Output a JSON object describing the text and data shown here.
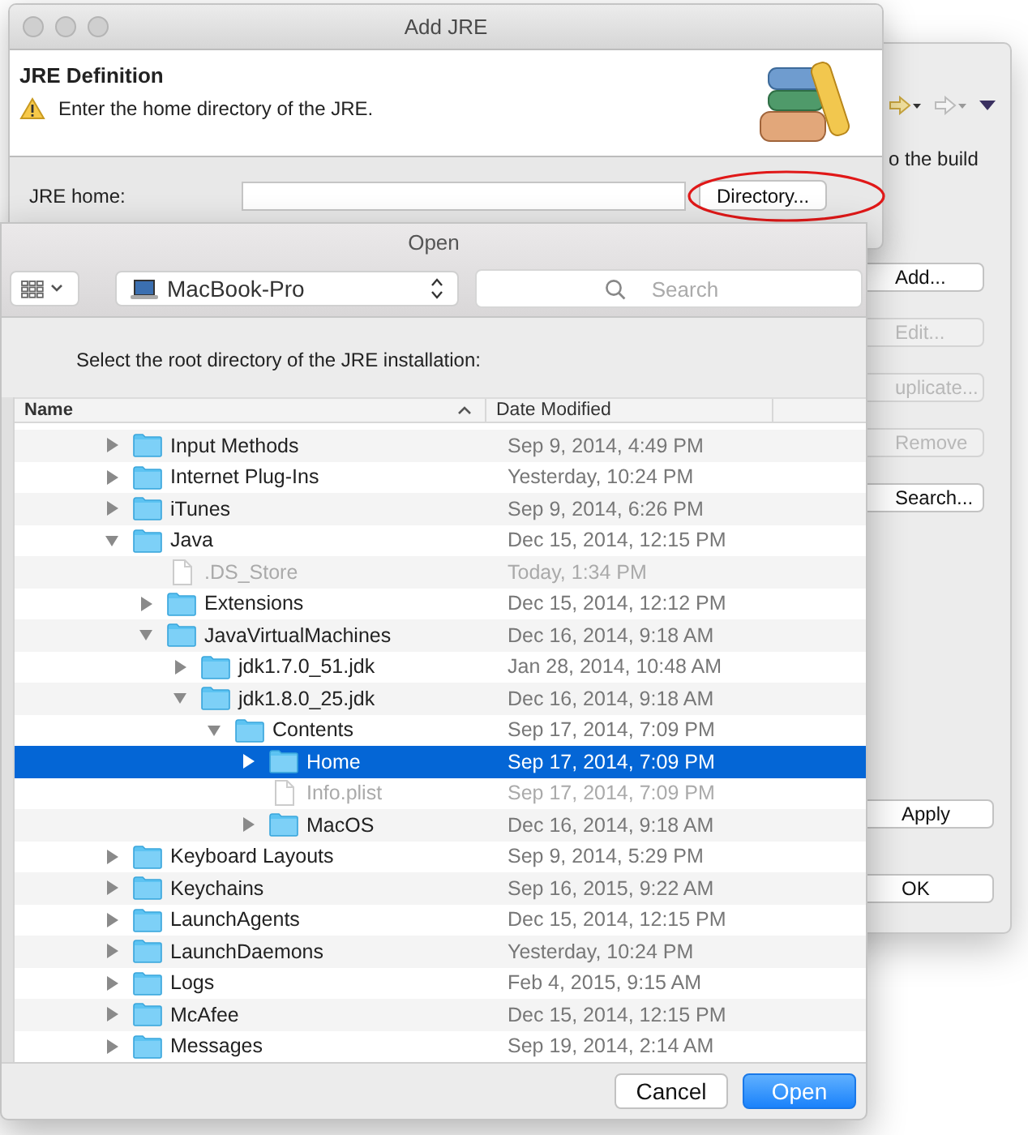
{
  "background_window": {
    "description_text": "o the build",
    "buttons": [
      {
        "label": "Add...",
        "disabled": false
      },
      {
        "label": "Edit...",
        "disabled": true
      },
      {
        "label": "uplicate...",
        "disabled": true
      },
      {
        "label": "Remove",
        "disabled": true
      },
      {
        "label": "Search...",
        "disabled": false
      }
    ],
    "footer_buttons": [
      {
        "label": "Apply"
      },
      {
        "label": "OK"
      }
    ]
  },
  "dialog": {
    "title": "Add JRE",
    "heading": "JRE Definition",
    "message": "Enter the home directory of the JRE.",
    "field_label": "JRE home:",
    "directory_button": "Directory..."
  },
  "open_sheet": {
    "title": "Open",
    "location": "MacBook-Pro",
    "search": {
      "placeholder": "Search"
    },
    "prompt": "Select the root directory of the JRE installation:",
    "columns": [
      {
        "label": "Name",
        "sorted": true
      },
      {
        "label": "Date Modified",
        "sorted": false
      }
    ],
    "files": [
      {
        "name": "Input Methods",
        "kind": "folder",
        "expanded": false,
        "selected": false,
        "date": "Sep 9, 2014, 4:49 PM"
      },
      {
        "name": "Internet Plug-Ins",
        "kind": "folder",
        "expanded": false,
        "selected": false,
        "date": "Yesterday, 10:24 PM"
      },
      {
        "name": "iTunes",
        "kind": "folder",
        "expanded": false,
        "selected": false,
        "date": "Sep 9, 2014, 6:26 PM"
      },
      {
        "name": "Java",
        "kind": "folder",
        "expanded": true,
        "selected": false,
        "date": "Dec 15, 2014, 12:15 PM",
        "children": [
          {
            "name": ".DS_Store",
            "kind": "file",
            "selected": false,
            "date": "Today, 1:34 PM"
          },
          {
            "name": "Extensions",
            "kind": "folder",
            "expanded": false,
            "selected": false,
            "date": "Dec 15, 2014, 12:12 PM"
          },
          {
            "name": "JavaVirtualMachines",
            "kind": "folder",
            "expanded": true,
            "selected": false,
            "date": "Dec 16, 2014, 9:18 AM",
            "children": [
              {
                "name": "jdk1.7.0_51.jdk",
                "kind": "folder",
                "expanded": false,
                "selected": false,
                "date": "Jan 28, 2014, 10:48 AM"
              },
              {
                "name": "jdk1.8.0_25.jdk",
                "kind": "folder",
                "expanded": true,
                "selected": false,
                "date": "Dec 16, 2014, 9:18 AM",
                "children": [
                  {
                    "name": "Contents",
                    "kind": "folder",
                    "expanded": true,
                    "selected": false,
                    "date": "Sep 17, 2014, 7:09 PM",
                    "children": [
                      {
                        "name": "Home",
                        "kind": "folder",
                        "expanded": false,
                        "selected": true,
                        "date": "Sep 17, 2014, 7:09 PM"
                      },
                      {
                        "name": "Info.plist",
                        "kind": "file",
                        "selected": false,
                        "date": "Sep 17, 2014, 7:09 PM"
                      },
                      {
                        "name": "MacOS",
                        "kind": "folder",
                        "expanded": false,
                        "selected": false,
                        "date": "Dec 16, 2014, 9:18 AM"
                      }
                    ]
                  }
                ]
              }
            ]
          }
        ]
      },
      {
        "name": "Keyboard Layouts",
        "kind": "folder",
        "expanded": false,
        "selected": false,
        "date": "Sep 9, 2014, 5:29 PM"
      },
      {
        "name": "Keychains",
        "kind": "folder",
        "expanded": false,
        "selected": false,
        "date": "Sep 16, 2015, 9:22 AM"
      },
      {
        "name": "LaunchAgents",
        "kind": "folder",
        "expanded": false,
        "selected": false,
        "date": "Dec 15, 2014, 12:15 PM"
      },
      {
        "name": "LaunchDaemons",
        "kind": "folder",
        "expanded": false,
        "selected": false,
        "date": "Yesterday, 10:24 PM"
      },
      {
        "name": "Logs",
        "kind": "folder",
        "expanded": false,
        "selected": false,
        "date": "Feb 4, 2015, 9:15 AM"
      },
      {
        "name": "McAfee",
        "kind": "folder",
        "expanded": false,
        "selected": false,
        "date": "Dec 15, 2014, 12:15 PM"
      },
      {
        "name": "Messages",
        "kind": "folder",
        "expanded": false,
        "selected": false,
        "date": "Sep 19, 2014, 2:14 AM"
      }
    ],
    "buttons": [
      {
        "label": "Cancel",
        "primary": false
      },
      {
        "label": "Open",
        "primary": true
      }
    ]
  }
}
